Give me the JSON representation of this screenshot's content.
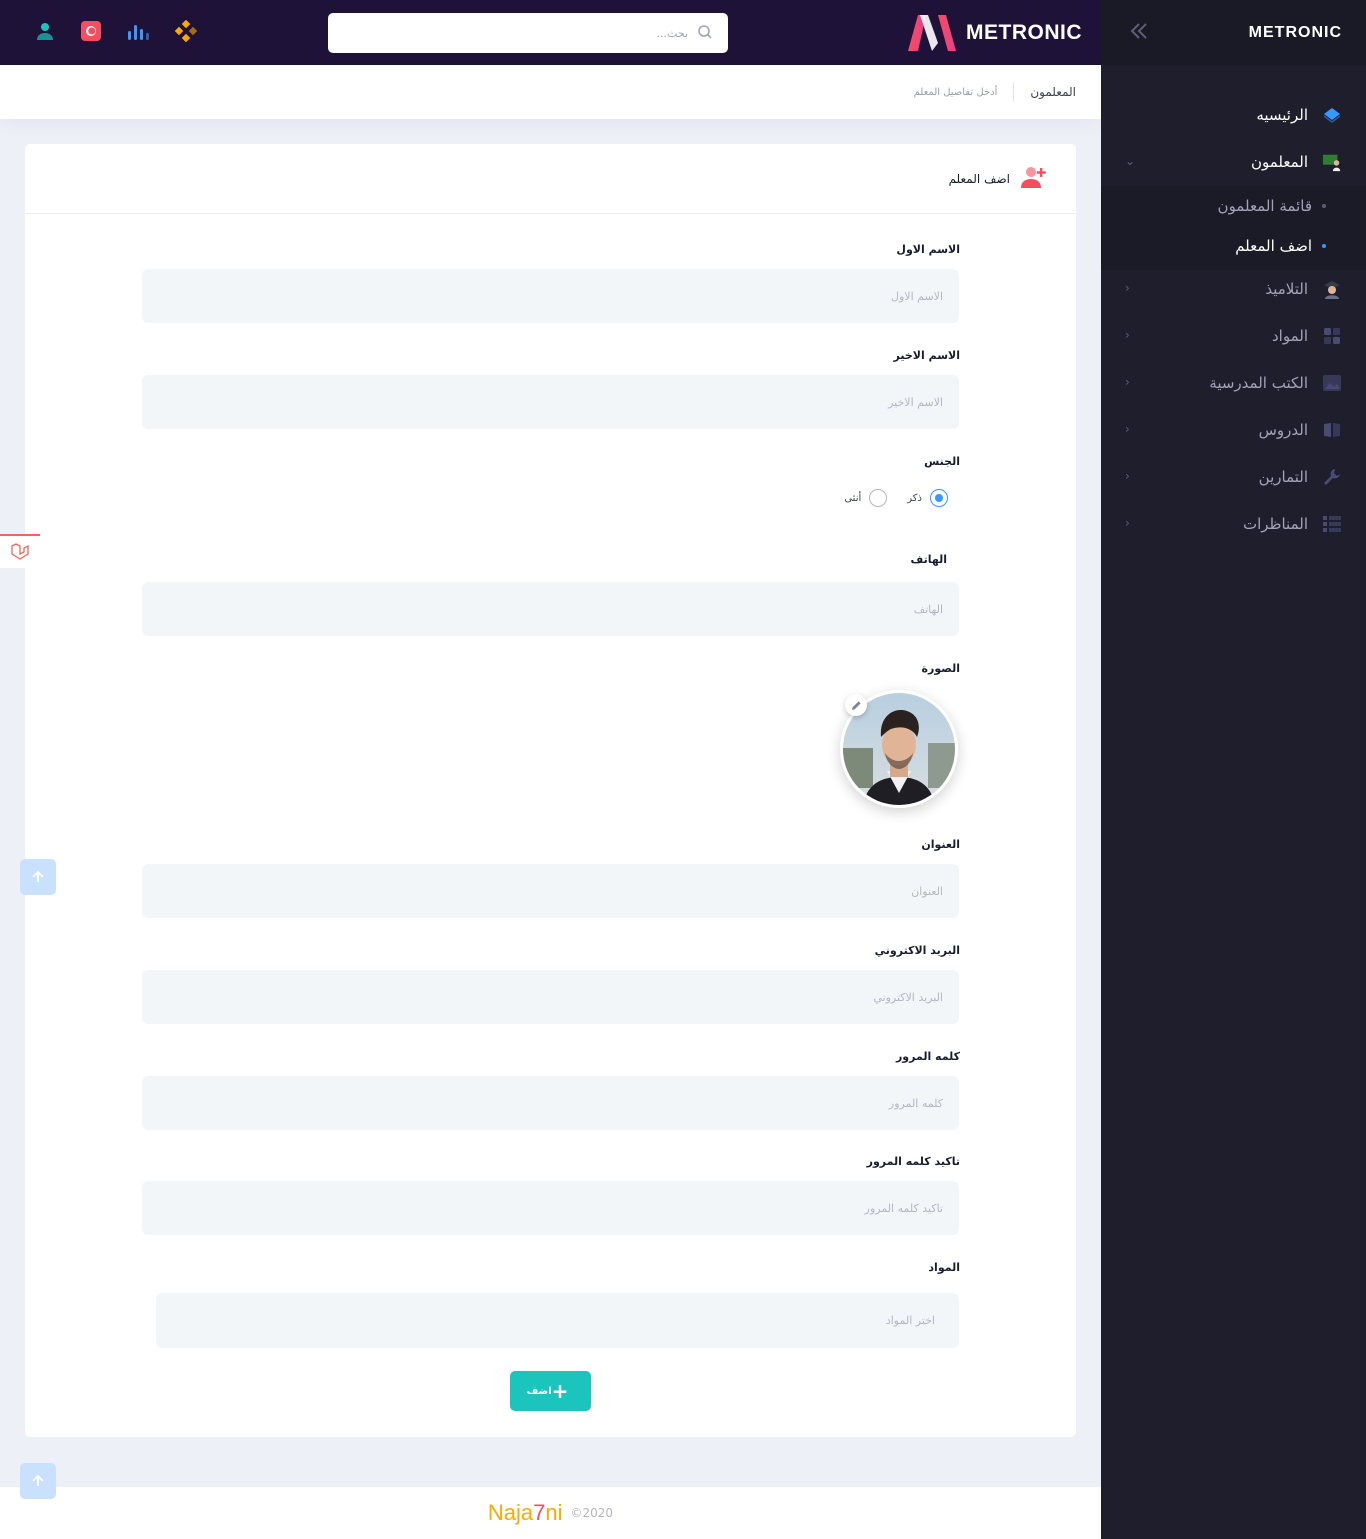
{
  "header": {
    "brand": "METRONIC",
    "search_placeholder": "بحث..."
  },
  "subheader": {
    "title": "المعلمون",
    "description": "أدخل تفاصيل المعلم"
  },
  "card": {
    "title": "اضف المعلم"
  },
  "form": {
    "first_name": {
      "label": "الاسم الاول",
      "placeholder": "الاسم الاول"
    },
    "last_name": {
      "label": "الاسم الاخير",
      "placeholder": "الاسم الاخير"
    },
    "gender": {
      "label": "الجنس",
      "options": [
        "ذكر",
        "أنثى"
      ],
      "selected": "ذكر"
    },
    "phone": {
      "label": "الهاتف",
      "placeholder": "الهاتف"
    },
    "photo": {
      "label": "الصورة"
    },
    "address": {
      "label": "العنوان",
      "placeholder": "العنوان"
    },
    "email": {
      "label": "البريد الاكتروني",
      "placeholder": "البريد الاكتروني"
    },
    "password": {
      "label": "كلمه المرور",
      "placeholder": "كلمه المرور"
    },
    "password_confirm": {
      "label": "تاكيد كلمه المرور",
      "placeholder": "تاكيد كلمه المرور"
    },
    "subjects": {
      "label": "المواد",
      "placeholder": "اختر المواد"
    },
    "submit_label": "اضف"
  },
  "footer": {
    "brand_parts": [
      "Naja",
      "7",
      "ni"
    ],
    "copyright": "©2020"
  },
  "sidebar": {
    "brand": "METRONIC",
    "items": [
      {
        "label": "الرئيسيه",
        "icon": "layers-icon"
      },
      {
        "label": "المعلمون",
        "icon": "teacher-icon"
      },
      {
        "label": "التلاميذ",
        "icon": "student-icon"
      },
      {
        "label": "المواد",
        "icon": "grid-icon"
      },
      {
        "label": "الكتب المدرسية",
        "icon": "image-icon"
      },
      {
        "label": "الدروس",
        "icon": "book-icon"
      },
      {
        "label": "التمارين",
        "icon": "wrench-icon"
      },
      {
        "label": "المناظرات",
        "icon": "list-icon"
      }
    ],
    "sub_items": [
      {
        "label": "قائمة المعلمون"
      },
      {
        "label": "اضف المعلم"
      }
    ]
  },
  "colors": {
    "topbar": "#1e1238",
    "sidebar": "#1e1e2d",
    "accent": "#3699ff",
    "success": "#1bc5bd",
    "danger": "#f64e60"
  }
}
